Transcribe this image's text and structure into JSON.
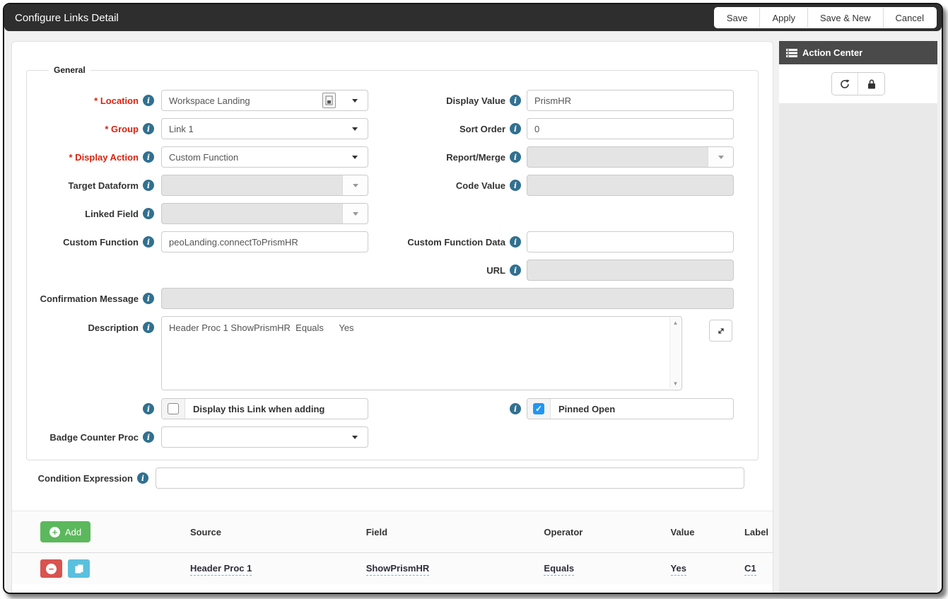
{
  "window": {
    "title": "Configure Links Detail",
    "buttons": [
      "Save",
      "Apply",
      "Save & New",
      "Cancel"
    ]
  },
  "action_center": {
    "title": "Action Center"
  },
  "general": {
    "legend": "General"
  },
  "fields": {
    "location": {
      "label": "* Location",
      "value": "Workspace Landing",
      "required": true
    },
    "display_value": {
      "label": "Display Value",
      "value": "PrismHR"
    },
    "group": {
      "label": "* Group",
      "value": "Link 1",
      "required": true
    },
    "sort_order": {
      "label": "Sort Order",
      "value": "0"
    },
    "display_action": {
      "label": "* Display Action",
      "value": "Custom Function",
      "required": true
    },
    "report_merge": {
      "label": "Report/Merge",
      "value": "",
      "disabled": true
    },
    "target_dataform": {
      "label": "Target Dataform",
      "value": "",
      "disabled": true
    },
    "code_value": {
      "label": "Code Value",
      "value": "",
      "disabled": true
    },
    "linked_field": {
      "label": "Linked Field",
      "value": "",
      "disabled": true
    },
    "custom_function": {
      "label": "Custom Function",
      "value": "peoLanding.connectToPrismHR"
    },
    "custom_function_data": {
      "label": "Custom Function Data",
      "value": ""
    },
    "url": {
      "label": "URL",
      "value": "",
      "disabled": true
    },
    "confirmation_message": {
      "label": "Confirmation Message",
      "value": "",
      "disabled": true
    },
    "description": {
      "label": "Description",
      "value": "Header Proc 1 ShowPrismHR  Equals      Yes"
    },
    "display_when_adding": {
      "label": "Display this Link when adding",
      "checked": false
    },
    "pinned_open": {
      "label": "Pinned Open",
      "checked": true
    },
    "badge_counter_proc": {
      "label": "Badge Counter Proc",
      "value": ""
    },
    "condition_expression": {
      "label": "Condition Expression",
      "value": ""
    }
  },
  "conditions": {
    "add_label": "Add",
    "columns": [
      "Source",
      "Field",
      "Operator",
      "Value",
      "Label"
    ],
    "rows": [
      {
        "source": "Header Proc 1",
        "field": "ShowPrismHR",
        "operator": "Equals",
        "value": "Yes",
        "label": "C1"
      }
    ]
  },
  "icons": {
    "info": "i",
    "scroll_up": "▲",
    "scroll_down": "▼",
    "plus": "+",
    "minus": "−"
  },
  "colors": {
    "titlebar": "#2e2e2e",
    "required_label": "#d9230f",
    "info_icon": "#31708f",
    "checkbox_checked": "#2196f3",
    "add_green": "#5cb85c",
    "delete_red": "#d9534f",
    "copy_blue": "#5bc0de",
    "action_center_header": "#4a4a4a",
    "disabled_field": "#e4e4e4"
  }
}
